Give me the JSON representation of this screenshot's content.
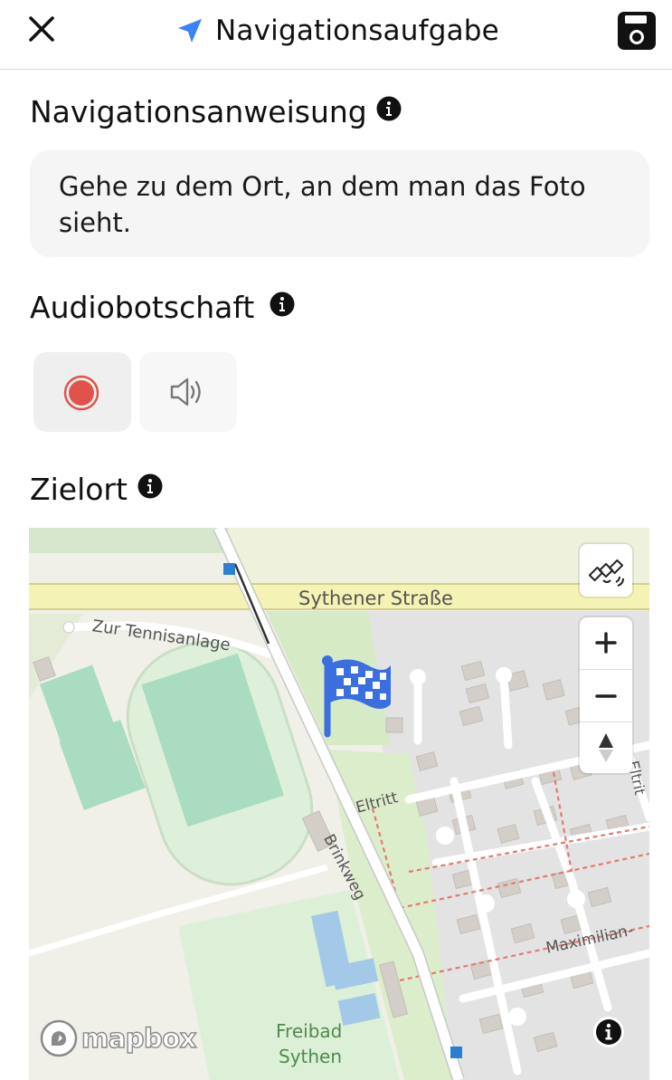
{
  "header": {
    "title": "Navigationsaufgabe",
    "close_icon": "close-icon",
    "nav_icon": "navigation-arrow-icon",
    "save_icon": "save-icon",
    "accent": "#3b82f6"
  },
  "instruction": {
    "label": "Navigationsanweisung",
    "text": "Gehe zu dem Ort, an dem man das Foto sieht."
  },
  "audio": {
    "label": "Audiobotschaft",
    "record_icon": "record-icon",
    "play_icon": "speaker-icon",
    "record_color": "#e0534b"
  },
  "destination": {
    "label": "Zielort",
    "map": {
      "labels": {
        "road_main": "Sythener Straße",
        "road_tennis": "Zur Tennisanlage",
        "road_brink": "Brinkweg",
        "road_eltritt": "Eltritt",
        "road_eltritt_2": "Eltrit",
        "road_maximilian": "Maximilian-",
        "pool_1": "Freibad",
        "pool_2": "Sythen"
      },
      "attribution": "mapbox",
      "marker_icon": "checkered-flag-icon",
      "marker_color": "#3b6fe0"
    }
  }
}
